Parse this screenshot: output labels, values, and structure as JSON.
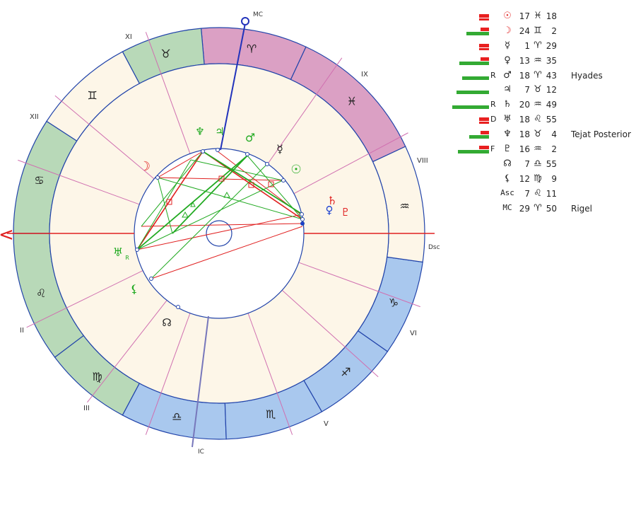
{
  "chart": {
    "mc_label": "MC",
    "ic_label": "IC",
    "dsc_label": "Dsc",
    "asc_marker": "<",
    "house_labels": [
      {
        "name": "II",
        "text": "II"
      },
      {
        "name": "III",
        "text": "III"
      },
      {
        "name": "V",
        "text": "V"
      },
      {
        "name": "VI",
        "text": "VI"
      },
      {
        "name": "VIII",
        "text": "VIII"
      },
      {
        "name": "IX",
        "text": "IX"
      },
      {
        "name": "XI",
        "text": "XI"
      },
      {
        "name": "XII",
        "text": "XII"
      }
    ],
    "signs": [
      {
        "name": "aries",
        "glyph": "♈",
        "color": "#dba0c4"
      },
      {
        "name": "taurus",
        "glyph": "♉",
        "color": "#b8d9b8"
      },
      {
        "name": "gemini",
        "glyph": "♊",
        "color": "#fdf6e8"
      },
      {
        "name": "cancer",
        "glyph": "♋",
        "color": "#b8d9b8"
      },
      {
        "name": "leo",
        "glyph": "♌",
        "color": "#b8d9b8"
      },
      {
        "name": "virgo",
        "glyph": "♍",
        "color": "#b8d9b8"
      },
      {
        "name": "libra",
        "glyph": "♎",
        "color": "#a9c8ee"
      },
      {
        "name": "scorpio",
        "glyph": "♏",
        "color": "#a9c8ee"
      },
      {
        "name": "sagittarius",
        "glyph": "♐",
        "color": "#a9c8ee"
      },
      {
        "name": "capricorn",
        "glyph": "♑",
        "color": "#a9c8ee"
      },
      {
        "name": "aquarius",
        "glyph": "♒",
        "color": "#fdf6e8"
      },
      {
        "name": "pisces",
        "glyph": "♓",
        "color": "#dba0c4"
      }
    ],
    "planets": [
      {
        "name": "moon",
        "glyph": "☽",
        "color": "#e02020"
      },
      {
        "name": "sun",
        "glyph": "☉",
        "color": "#22aa22"
      },
      {
        "name": "mercury",
        "glyph": "☿",
        "color": "#222222"
      },
      {
        "name": "venus",
        "glyph": "♀",
        "color": "#1a3fcf"
      },
      {
        "name": "mars",
        "glyph": "♂",
        "color": "#22aa22"
      },
      {
        "name": "jupiter",
        "glyph": "♃",
        "color": "#22aa22"
      },
      {
        "name": "saturn",
        "glyph": "♄",
        "color": "#e02020"
      },
      {
        "name": "uranus",
        "glyph": "♅",
        "color": "#22aa22"
      },
      {
        "name": "uranus-retro",
        "glyph": "R",
        "color": "#22aa22"
      },
      {
        "name": "neptune",
        "glyph": "♆",
        "color": "#22aa22"
      },
      {
        "name": "pluto",
        "glyph": "♇",
        "color": "#e02020"
      },
      {
        "name": "lilith",
        "glyph": "⚸",
        "color": "#22aa22"
      },
      {
        "name": "node",
        "glyph": "☊",
        "color": "#222222"
      }
    ],
    "colors": {
      "wheel_line": "#2244aa",
      "house_bg": "#fdf6e8",
      "house_line": "#d070b0",
      "axis_red": "#e02020",
      "axis_blue": "#2233bb",
      "aspect_red": "#e02020",
      "aspect_green": "#22aa22"
    }
  },
  "table": {
    "rows": [
      {
        "glyph": "☉",
        "glyph_color": "#e02020",
        "flag": "",
        "deg": "17",
        "sign": "♓",
        "min": "18",
        "star": "",
        "green": 0,
        "red": 14
      },
      {
        "glyph": "☽",
        "glyph_color": "#e02020",
        "flag": "",
        "deg": "24",
        "sign": "♊",
        "min": "2",
        "star": "",
        "green": 32,
        "red": 12
      },
      {
        "glyph": "☿",
        "glyph_color": "#222222",
        "flag": "",
        "deg": "1",
        "sign": "♈",
        "min": "29",
        "star": "",
        "green": 0,
        "red": 14
      },
      {
        "glyph": "♀",
        "glyph_color": "#222222",
        "flag": "",
        "deg": "13",
        "sign": "♒",
        "min": "35",
        "star": "",
        "green": 42,
        "red": 12
      },
      {
        "glyph": "♂",
        "glyph_color": "#222222",
        "flag": "R",
        "deg": "18",
        "sign": "♈",
        "min": "43",
        "star": "Hyades",
        "green": 38,
        "red": 0
      },
      {
        "glyph": "♃",
        "glyph_color": "#222222",
        "flag": "",
        "deg": "7",
        "sign": "♉",
        "min": "12",
        "star": "",
        "green": 46,
        "red": 0
      },
      {
        "glyph": "♄",
        "glyph_color": "#222222",
        "flag": "R",
        "deg": "20",
        "sign": "♒",
        "min": "49",
        "star": "",
        "green": 52,
        "red": 0
      },
      {
        "glyph": "♅",
        "glyph_color": "#222222",
        "flag": "D",
        "deg": "18",
        "sign": "♌",
        "min": "55",
        "star": "",
        "green": 0,
        "red": 14
      },
      {
        "glyph": "♆",
        "glyph_color": "#222222",
        "flag": "",
        "deg": "18",
        "sign": "♉",
        "min": "4",
        "star": "Tejat Posterior",
        "green": 28,
        "red": 12
      },
      {
        "glyph": "♇",
        "glyph_color": "#222222",
        "flag": "F",
        "deg": "16",
        "sign": "♒",
        "min": "2",
        "star": "",
        "green": 44,
        "red": 14
      },
      {
        "glyph": "☊",
        "glyph_color": "#222222",
        "flag": "",
        "deg": "7",
        "sign": "♎",
        "min": "55",
        "star": "",
        "green": 0,
        "red": 0
      },
      {
        "glyph": "⚸",
        "glyph_color": "#222222",
        "flag": "",
        "deg": "12",
        "sign": "♍",
        "min": "9",
        "star": "",
        "green": 0,
        "red": 0
      },
      {
        "glyph": "Asc",
        "glyph_color": "#222222",
        "flag": "",
        "deg": "7",
        "sign": "♌",
        "min": "11",
        "star": "",
        "green": 0,
        "red": 0
      },
      {
        "glyph": "MC",
        "glyph_color": "#222222",
        "flag": "",
        "deg": "29",
        "sign": "♈",
        "min": "50",
        "star": "Rigel",
        "green": 0,
        "red": 0
      }
    ]
  }
}
